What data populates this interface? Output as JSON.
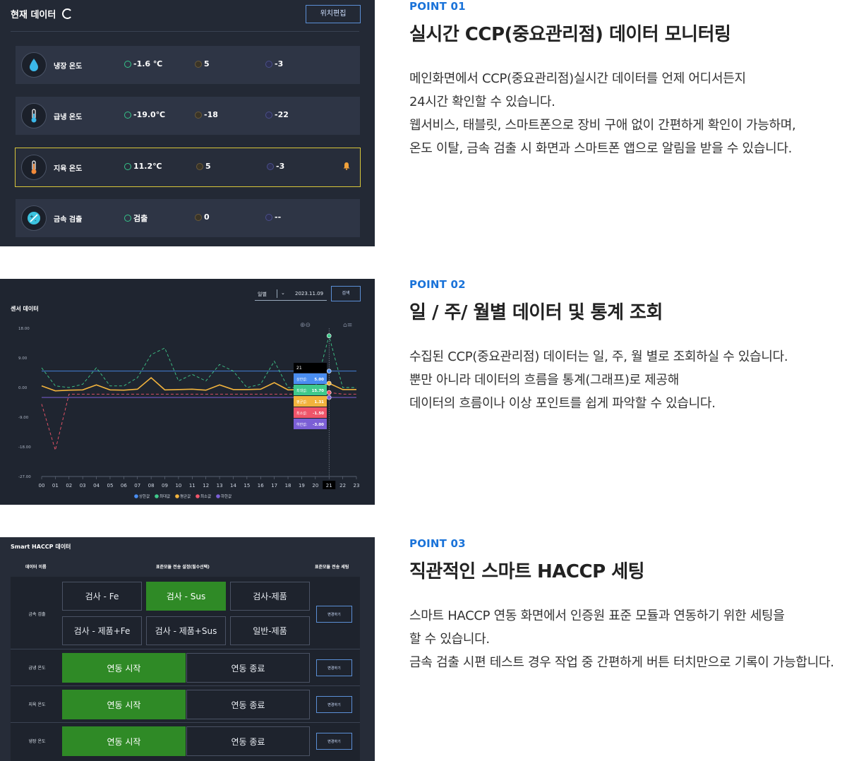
{
  "sections": [
    {
      "point": "POINT 01",
      "heading": "실시간 CCP(중요관리점) 데이터 모니터링",
      "lines": [
        "메인화면에서 CCP(중요관리점)실시간 데이터를 언제 어디서든지",
        "24시간 확인할 수 있습니다.",
        "웹서비스, 태블릿, 스마트폰으로 장비 구애 없이 간편하게 확인이 가능하며,",
        "온도 이탈, 금속 검출 시 화면과 스마트폰 앱으로 알림을 받을 수 있습니다."
      ]
    },
    {
      "point": "POINT 02",
      "heading": "일 / 주/ 월별 데이터 및 통계 조회",
      "lines": [
        "수집된 CCP(중요관리점) 데이터는 일, 주, 월 별로 조회하실 수 있습니다.",
        "뿐만 아니라 데이터의 흐름을 통계(그래프)로 제공해",
        "데이터의 흐름이나 이상 포인트를 쉽게 파악할 수 있습니다."
      ]
    },
    {
      "point": "POINT 03",
      "heading": "직관적인 스마트 HACCP 세팅",
      "lines": [
        "스마트 HACCP 연동 화면에서 인증원 표준 모듈과 연동하기 위한 세팅을",
        "할 수 있습니다.",
        "금속 검출 시편 테스트 경우 작업 중 간편하게 버튼 터치만으로 기록이 가능합니다."
      ]
    }
  ],
  "monitor": {
    "title": "현재 데이터",
    "edit_button": "위치편집",
    "rows": [
      {
        "label": "냉장 온도",
        "current": "-1.6 ℃",
        "upper": "5",
        "lower": "-3",
        "icon": "water-drop-icon",
        "alert": false
      },
      {
        "label": "급냉 온도",
        "current": "-19.0℃",
        "upper": "-18",
        "lower": "-22",
        "icon": "thermometer-icon",
        "alert": false
      },
      {
        "label": "지육 온도",
        "current": "11.2℃",
        "upper": "5",
        "lower": "-3",
        "icon": "thermometer-icon",
        "alert": true
      },
      {
        "label": "금속 검출",
        "current": "검출",
        "upper": "0",
        "lower": "--",
        "icon": "metal-detect-icon",
        "alert": false
      }
    ]
  },
  "sensor": {
    "title": "센서 데이터",
    "period": "일별",
    "date": "2023.11.09",
    "search_button": "검색",
    "tooltip": {
      "hour": "21",
      "items": [
        {
          "label": "상한값",
          "value": "5.00",
          "color": "#4a8df0"
        },
        {
          "label": "최대값",
          "value": "15.70",
          "color": "#3fc98b"
        },
        {
          "label": "평균값",
          "value": "1.31",
          "color": "#f2b33d"
        },
        {
          "label": "최소값",
          "value": "-1.50",
          "color": "#f0556a"
        },
        {
          "label": "하한값",
          "value": "-3.00",
          "color": "#7b5fd6"
        }
      ]
    }
  },
  "chart_data": {
    "type": "line",
    "x": [
      "00",
      "01",
      "02",
      "03",
      "04",
      "05",
      "06",
      "07",
      "08",
      "09",
      "10",
      "11",
      "12",
      "13",
      "14",
      "15",
      "16",
      "17",
      "18",
      "19",
      "20",
      "21",
      "22",
      "23"
    ],
    "yticks": [
      "18.00",
      "9.00",
      "0.00",
      "-9.00",
      "-18.00",
      "-27.00"
    ],
    "ylim": [
      -27,
      18
    ],
    "series": [
      {
        "name": "상한값",
        "color": "#4a8df0",
        "style": "solid",
        "values": [
          5,
          5,
          5,
          5,
          5,
          5,
          5,
          5,
          5,
          5,
          5,
          5,
          5,
          5,
          5,
          5,
          5,
          5,
          5,
          5,
          5,
          5,
          5,
          5
        ]
      },
      {
        "name": "최대값",
        "color": "#3fc98b",
        "style": "dashed",
        "values": [
          6,
          0.5,
          0,
          1,
          6,
          0.5,
          0.5,
          3,
          10,
          12,
          2,
          4,
          2,
          7,
          5,
          0,
          1,
          8,
          0,
          0,
          0,
          15.7,
          0,
          0
        ]
      },
      {
        "name": "평균값",
        "color": "#f2b33d",
        "style": "solid",
        "values": [
          0.5,
          -1,
          -0.8,
          -0.7,
          0.8,
          -0.7,
          -0.8,
          -0.5,
          3,
          -0.7,
          -0.6,
          -0.5,
          -0.8,
          0.8,
          -0.6,
          -0.6,
          -0.5,
          1.5,
          -0.7,
          -0.6,
          -0.5,
          1.31,
          -0.6,
          -0.6
        ]
      },
      {
        "name": "최소값",
        "color": "#f0556a",
        "style": "dashed",
        "values": [
          -5,
          -19,
          -2,
          -2,
          -2,
          -2,
          -2,
          -2,
          -2,
          -2,
          -2,
          -2,
          -2,
          -2,
          -2,
          -2,
          -2,
          -2,
          -2,
          -2,
          -2,
          -1.5,
          -2,
          -2
        ]
      },
      {
        "name": "하한값",
        "color": "#7b5fd6",
        "style": "solid",
        "values": [
          -3,
          -3,
          -3,
          -3,
          -3,
          -3,
          -3,
          -3,
          -3,
          -3,
          -3,
          -3,
          -3,
          -3,
          -3,
          -3,
          -3,
          -3,
          -3,
          -3,
          -3,
          -3,
          -3,
          -3
        ]
      }
    ],
    "highlight_x": "21"
  },
  "haccp": {
    "title": "Smart HACCP 데이터",
    "col_name": "데이터 이름",
    "col_setting": "표준모듈 전송 설정(필수선택)",
    "col_action": "표준모듈 전송 세팅",
    "metal": {
      "label": "금속 검출",
      "options": [
        "검사 - Fe",
        "검사 - Sus",
        "검사-제품",
        "검사 - 제품+Fe",
        "검사 - 제품+Sus",
        "일반-제품"
      ],
      "selected_index": 1,
      "button": "변경하기"
    },
    "temps": [
      {
        "label": "급냉 온도",
        "start": "연동 시작",
        "stop": "연동 종료",
        "button": "변경하기"
      },
      {
        "label": "지육 온도",
        "start": "연동 시작",
        "stop": "연동 종료",
        "button": "변경하기"
      },
      {
        "label": "냉장 온도",
        "start": "연동 시작",
        "stop": "연동 종료",
        "button": "변경하기"
      }
    ]
  }
}
